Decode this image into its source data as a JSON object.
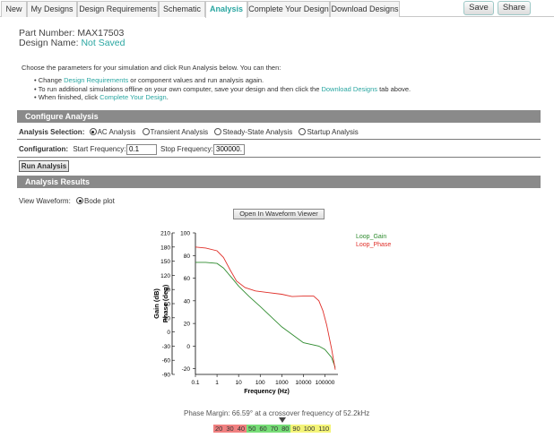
{
  "tabs": [
    {
      "label": "New",
      "active": false
    },
    {
      "label": "My Designs",
      "active": false
    },
    {
      "label": "Design Requirements",
      "active": false
    },
    {
      "label": "Schematic",
      "active": false
    },
    {
      "label": "Analysis",
      "active": true
    },
    {
      "label": "Complete Your Design",
      "active": false
    },
    {
      "label": "Download Designs",
      "active": false
    }
  ],
  "toolbar": {
    "save_label": "Save",
    "share_label": "Share"
  },
  "part": {
    "label": "Part Number:",
    "value": "MAX17503"
  },
  "design": {
    "label": "Design Name:",
    "value": "Not Saved"
  },
  "intro": {
    "text": "Choose the parameters for your simulation and click Run Analysis below. You can then:",
    "b1_pre": "Change ",
    "b1_link": "Design Requirements",
    "b1_post": " or component values and run analysis again.",
    "b2_pre": "To run additional simulations offline on your own computer, save your design and then click the ",
    "b2_link": "Download Designs",
    "b2_post": " tab above.",
    "b3_pre": "When finished, click ",
    "b3_link": "Complete Your Design",
    "b3_post": "."
  },
  "configure": {
    "header": "Configure Analysis",
    "selection_label": "Analysis Selection:",
    "options": [
      "AC Analysis",
      "Transient Analysis",
      "Steady-State Analysis",
      "Startup Analysis"
    ],
    "selected": "AC Analysis",
    "config_label": "Configuration:",
    "start_label": "Start Frequency:",
    "start_value": "0.1",
    "stop_label": "Stop Frequency:",
    "stop_value": "300000."
  },
  "run_label": "Run Analysis",
  "results": {
    "header": "Analysis Results",
    "view_label": "View Waveform:",
    "view_option": "Bode plot",
    "open_viewer_label": "Open In Waveform Viewer"
  },
  "chart_data": {
    "type": "line",
    "xlabel": "Frequency (Hz)",
    "ylabel": "Gain (dB)",
    "ylabel2": "Phase (deg)",
    "xscale": "log",
    "xlim": [
      0.1,
      400000
    ],
    "x_ticks": [
      "0.1",
      "1",
      "10",
      "100",
      "1000",
      "10000",
      "100000"
    ],
    "ylim": [
      -25,
      100
    ],
    "y_ticks": [
      -20,
      0,
      20,
      40,
      60,
      80,
      100
    ],
    "ylim2": [
      -90,
      210
    ],
    "y2_ticks": [
      -90,
      -60,
      -30,
      0,
      30,
      60,
      90,
      120,
      150,
      180,
      210
    ],
    "grid": false,
    "legend_position": "top-right",
    "series": [
      {
        "name": "Loop_Gain",
        "color": "#2e8b2e",
        "axis": "left",
        "x": [
          0.1,
          0.3,
          1,
          2,
          5,
          10,
          30,
          100,
          1000,
          10000,
          52200,
          100000,
          200000,
          300000
        ],
        "y": [
          74,
          74,
          73,
          69,
          60,
          53,
          44,
          35,
          17,
          3,
          0,
          -3,
          -10,
          -19
        ]
      },
      {
        "name": "Loop_Phase",
        "color": "#e0302a",
        "axis": "right",
        "x": [
          0.1,
          0.3,
          1,
          2,
          4,
          8,
          20,
          60,
          200,
          1000,
          3000,
          10000,
          30000,
          52200,
          80000,
          120000,
          200000,
          300000
        ],
        "y": [
          180,
          178,
          172,
          158,
          132,
          108,
          94,
          87,
          84,
          80,
          75,
          76,
          76,
          66,
          45,
          15,
          -35,
          -80
        ]
      }
    ]
  },
  "phase_margin": {
    "text": "Phase Margin: 66.59° at a crossover frequency of 52.2kHz",
    "value_deg": 66.59,
    "scale": [
      {
        "label": "20",
        "color": "#f08080"
      },
      {
        "label": "30",
        "color": "#f08080"
      },
      {
        "label": "40",
        "color": "#f08080"
      },
      {
        "label": "50",
        "color": "#77dd77"
      },
      {
        "label": "60",
        "color": "#77dd77"
      },
      {
        "label": "70",
        "color": "#77dd77"
      },
      {
        "label": "80",
        "color": "#77dd77"
      },
      {
        "label": "90",
        "color": "#f4f478"
      },
      {
        "label": "100",
        "color": "#f4f478"
      },
      {
        "label": "110",
        "color": "#f4f478"
      }
    ]
  }
}
